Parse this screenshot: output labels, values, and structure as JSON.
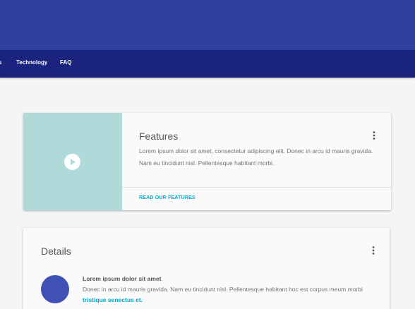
{
  "nav": {
    "items": [
      {
        "label": "s"
      },
      {
        "label": "Technology"
      },
      {
        "label": "FAQ"
      }
    ]
  },
  "features_card": {
    "title": "Features",
    "text": "Lorem ipsum dolor sit amet, consectetur adipiscing elit. Donec in arcu id mauris gravida. Nam eu tincidunt nisl. Pellentesque habitant morbi.",
    "link_label": "READ OUR FEATURES",
    "media_color": "#b0dad9"
  },
  "details_card": {
    "title": "Details",
    "item": {
      "heading": "Lorem ipsum dolor sit amet",
      "body": "Donec in arcu id mauris gravida. Nam eu tincidunt nisl. Pellentesque habitant hoc est corpus meum morbi ",
      "link_text": "tristique senectus et."
    }
  },
  "colors": {
    "header": "#303f9f",
    "nav": "#1a237e",
    "accent": "#00a9c5",
    "avatar": "#3f51b5"
  },
  "icons": [
    "play-icon",
    "more-vert-icon"
  ]
}
